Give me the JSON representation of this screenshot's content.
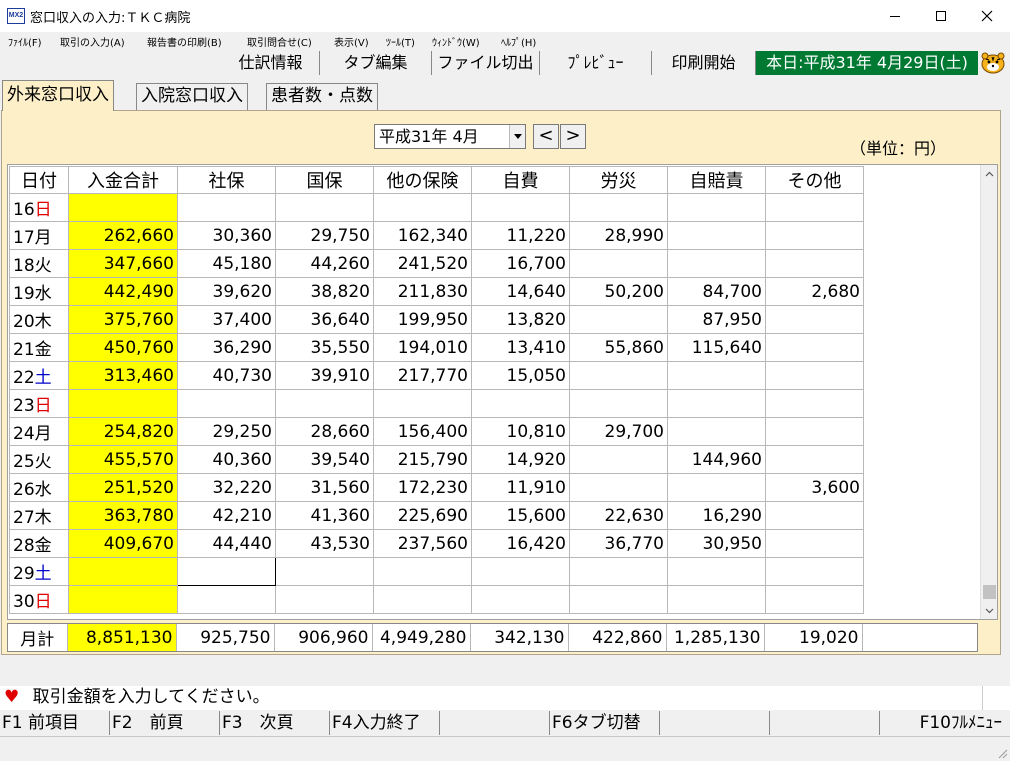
{
  "window": {
    "app_icon": "MX2",
    "title": "窓口収入の入力:ＴＫＣ病院",
    "icons": [
      "minimize-icon",
      "maximize-icon",
      "close-icon"
    ]
  },
  "menu": [
    "ﾌｧｲﾙ(F)",
    "取引の入力(A)",
    "報告書の印刷(B)",
    "取引問合せ(C)",
    "表示(V)",
    "ﾂｰﾙ(T)",
    "ｳｨﾝﾄﾞｳ(W)",
    "ﾍﾙﾌﾟ(H)"
  ],
  "toolbar": {
    "buttons": [
      "仕訳情報",
      "タブ編集",
      "ファイル切出",
      "ﾌﾟﾚﾋﾞｭｰ",
      "印刷開始"
    ],
    "today": "本日:平成31年 4月29日(土)",
    "today_bg": "#007a33",
    "mascot_icon": "tiger-icon"
  },
  "tabs": [
    "外来窓口収入",
    "入院窓口収入",
    "患者数・点数"
  ],
  "period": {
    "value": "平成31年  4月",
    "prev": "<",
    "next": ">"
  },
  "unit": "（単位：円）",
  "grid": {
    "columns": [
      "日付",
      "入金合計",
      "社保",
      "国保",
      "他の保険",
      "自費",
      "労災",
      "自賠責",
      "その他"
    ],
    "rows": [
      {
        "day": "16",
        "dow": "日",
        "dow_type": "red",
        "total": "",
        "values": [
          "",
          "",
          "",
          "",
          "",
          "",
          ""
        ]
      },
      {
        "day": "17",
        "dow": "月",
        "dow_type": "normal",
        "total": "262,660",
        "values": [
          "30,360",
          "29,750",
          "162,340",
          "11,220",
          "28,990",
          "",
          ""
        ]
      },
      {
        "day": "18",
        "dow": "火",
        "dow_type": "normal",
        "total": "347,660",
        "values": [
          "45,180",
          "44,260",
          "241,520",
          "16,700",
          "",
          "",
          ""
        ]
      },
      {
        "day": "19",
        "dow": "水",
        "dow_type": "normal",
        "total": "442,490",
        "values": [
          "39,620",
          "38,820",
          "211,830",
          "14,640",
          "50,200",
          "84,700",
          "2,680"
        ]
      },
      {
        "day": "20",
        "dow": "木",
        "dow_type": "normal",
        "total": "375,760",
        "values": [
          "37,400",
          "36,640",
          "199,950",
          "13,820",
          "",
          "87,950",
          ""
        ]
      },
      {
        "day": "21",
        "dow": "金",
        "dow_type": "normal",
        "total": "450,760",
        "values": [
          "36,290",
          "35,550",
          "194,010",
          "13,410",
          "55,860",
          "115,640",
          ""
        ]
      },
      {
        "day": "22",
        "dow": "土",
        "dow_type": "blue",
        "total": "313,460",
        "values": [
          "40,730",
          "39,910",
          "217,770",
          "15,050",
          "",
          "",
          ""
        ]
      },
      {
        "day": "23",
        "dow": "日",
        "dow_type": "red",
        "total": "",
        "values": [
          "",
          "",
          "",
          "",
          "",
          "",
          ""
        ]
      },
      {
        "day": "24",
        "dow": "月",
        "dow_type": "normal",
        "total": "254,820",
        "values": [
          "29,250",
          "28,660",
          "156,400",
          "10,810",
          "29,700",
          "",
          ""
        ]
      },
      {
        "day": "25",
        "dow": "火",
        "dow_type": "normal",
        "total": "455,570",
        "values": [
          "40,360",
          "39,540",
          "215,790",
          "14,920",
          "",
          "144,960",
          ""
        ]
      },
      {
        "day": "26",
        "dow": "水",
        "dow_type": "normal",
        "total": "251,520",
        "values": [
          "32,220",
          "31,560",
          "172,230",
          "11,910",
          "",
          "",
          "3,600"
        ]
      },
      {
        "day": "27",
        "dow": "木",
        "dow_type": "normal",
        "total": "363,780",
        "values": [
          "42,210",
          "41,360",
          "225,690",
          "15,600",
          "22,630",
          "16,290",
          ""
        ]
      },
      {
        "day": "28",
        "dow": "金",
        "dow_type": "normal",
        "total": "409,670",
        "values": [
          "44,440",
          "43,530",
          "237,560",
          "16,420",
          "36,770",
          "30,950",
          ""
        ]
      },
      {
        "day": "29",
        "dow": "土",
        "dow_type": "blue",
        "total": "",
        "values": [
          "",
          "",
          "",
          "",
          "",
          "",
          ""
        ]
      },
      {
        "day": "30",
        "dow": "日",
        "dow_type": "red",
        "total": "",
        "values": [
          "",
          "",
          "",
          "",
          "",
          "",
          ""
        ]
      }
    ],
    "totals": {
      "label": "月計",
      "total": "8,851,130",
      "values": [
        "925,750",
        "906,960",
        "4,949,280",
        "342,130",
        "422,860",
        "1,285,130",
        "19,020"
      ]
    },
    "highlight_color": "#ffff00"
  },
  "status": {
    "icon": "heart-icon",
    "message": "取引金額を入力してください。"
  },
  "fkeys": [
    "F1 前項目",
    "F2　前頁",
    "F3　次頁",
    "F4入力終了",
    "",
    "F6タブ切替",
    "",
    "",
    "F10ﾌﾙﾒﾆｭｰ"
  ]
}
